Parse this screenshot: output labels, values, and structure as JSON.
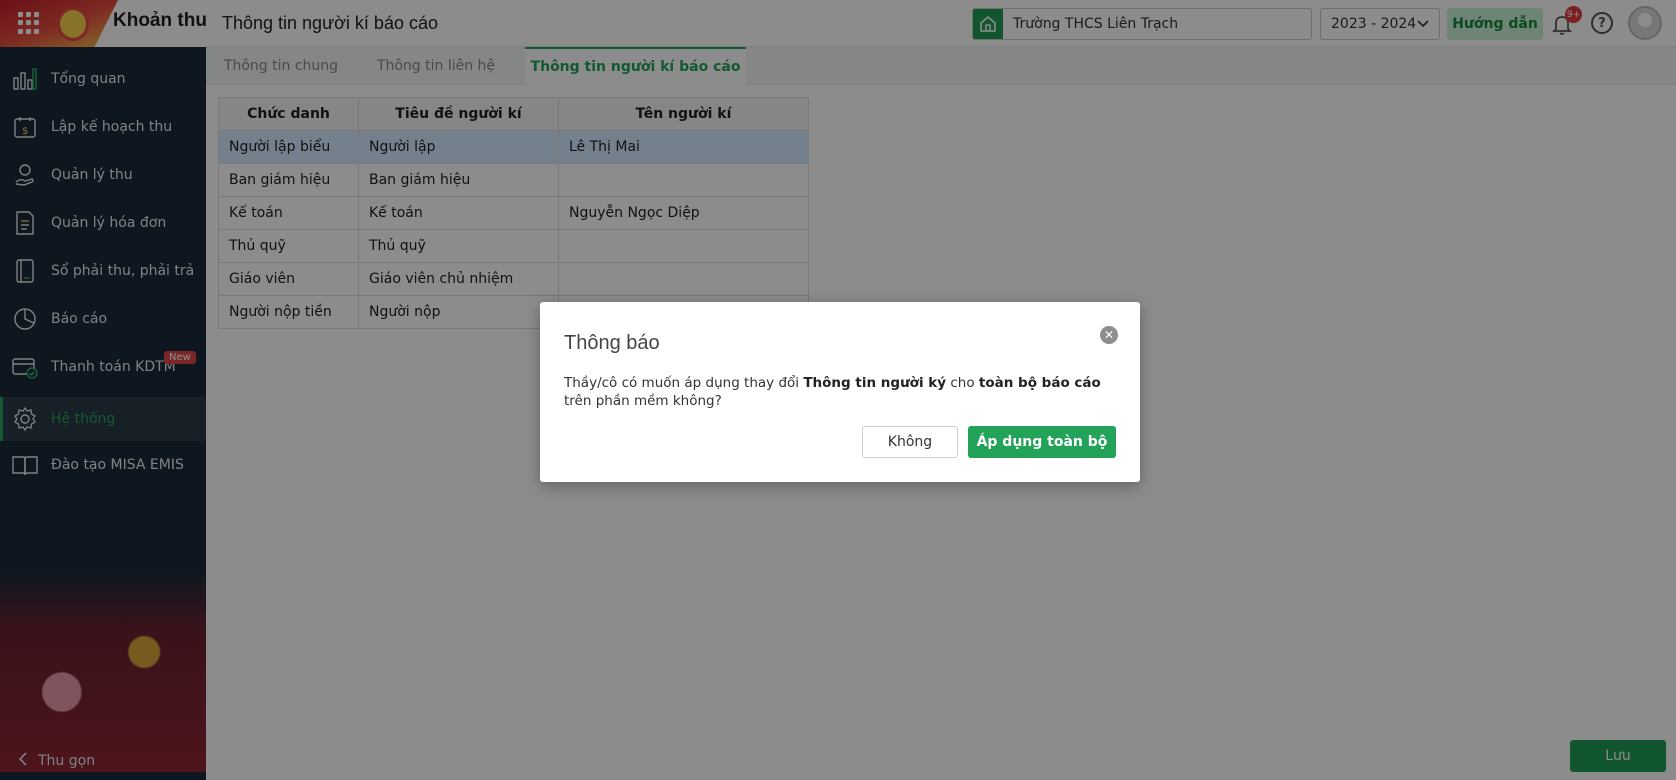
{
  "header": {
    "brand": "Khoản thu",
    "page_title": "Thông tin người kí báo cáo",
    "school": "Trường THCS Liên Trạch",
    "year": "2023 - 2024",
    "guide_label": "Hướng dẫn",
    "notification_badge": "9+",
    "help_symbol": "?"
  },
  "sidebar": {
    "items": [
      {
        "label": "Tổng quan",
        "icon": "bar-chart-icon"
      },
      {
        "label": "Lập kế hoạch thu",
        "icon": "calendar-money-icon"
      },
      {
        "label": "Quản lý thu",
        "icon": "hand-coin-icon"
      },
      {
        "label": "Quản lý hóa đơn",
        "icon": "invoice-icon"
      },
      {
        "label": "Sổ phải thu, phải trả",
        "icon": "ledger-icon"
      },
      {
        "label": "Báo cáo",
        "icon": "pie-chart-icon"
      },
      {
        "label": "Thanh toán KDTM",
        "icon": "card-check-icon",
        "badge": "New"
      },
      {
        "label": "Hệ thống",
        "icon": "gear-icon",
        "active": true
      },
      {
        "label": "Đào tạo MISA EMIS",
        "icon": "book-icon"
      }
    ],
    "collapse_label": "Thu gọn"
  },
  "tabs": [
    {
      "label": "Thông tin chung"
    },
    {
      "label": "Thông tin liên hệ"
    },
    {
      "label": "Thông tin người kí báo cáo",
      "active": true
    }
  ],
  "table": {
    "headers": [
      "Chức danh",
      "Tiêu đề người kí",
      "Tên người kí"
    ],
    "rows": [
      [
        "Người lập biểu",
        "Người lập",
        "Lê Thị Mai"
      ],
      [
        "Ban giám hiệu",
        "Ban giám hiệu",
        ""
      ],
      [
        "Kế toán",
        "Kế toán",
        "Nguyễn Ngọc Diệp"
      ],
      [
        "Thủ quỹ",
        "Thủ quỹ",
        ""
      ],
      [
        "Giáo viên",
        "Giáo viên chủ nhiệm",
        ""
      ],
      [
        "Người nộp tiền",
        "Người nộp",
        ""
      ]
    ]
  },
  "save_label": "Lưu",
  "modal": {
    "title": "Thông báo",
    "msg_part1": "Thầy/cô có muốn áp dụng thay đổi ",
    "msg_bold1": "Thông tin người ký",
    "msg_part2": " cho ",
    "msg_bold2": "toàn bộ báo cáo",
    "msg_part3": " trên phần mềm không?",
    "close_symbol": "✕",
    "no_label": "Không",
    "apply_label": "Áp dụng toàn bộ"
  },
  "colors": {
    "accent": "#23a25a",
    "sidebar_bg": "#1b2b3a",
    "selected_row": "#d3ecff"
  }
}
